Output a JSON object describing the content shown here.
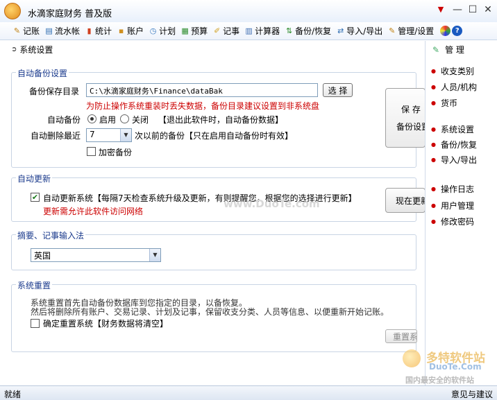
{
  "window": {
    "title": "水滴家庭财务  普及版",
    "controls": [
      "▼",
      "—",
      "☐",
      "✕"
    ]
  },
  "toolbar": {
    "items": [
      {
        "label": "记账",
        "icon": "pen-icon",
        "glyph": "✎",
        "color": "#c08010"
      },
      {
        "label": "流水帐",
        "icon": "list-icon",
        "glyph": "▤",
        "color": "#2a6ab0"
      },
      {
        "label": "统计",
        "icon": "bar-chart-icon",
        "glyph": "▮",
        "color": "#d04020"
      },
      {
        "label": "账户",
        "icon": "wallet-icon",
        "glyph": "▪",
        "color": "#d09020"
      },
      {
        "label": "计划",
        "icon": "plan-icon",
        "glyph": "◷",
        "color": "#3a7ac0"
      },
      {
        "label": "预算",
        "icon": "calculator-icon",
        "glyph": "▦",
        "color": "#2a8a2a"
      },
      {
        "label": "记事",
        "icon": "note-icon",
        "glyph": "✐",
        "color": "#d0a020"
      },
      {
        "label": "计算器",
        "icon": "calc-icon",
        "glyph": "▥",
        "color": "#3a6ab0"
      },
      {
        "label": "备份/恢复",
        "icon": "backup-icon",
        "glyph": "⇅",
        "color": "#2a8a2a"
      },
      {
        "label": "导入/导出",
        "icon": "import-export-icon",
        "glyph": "⇄",
        "color": "#2a6ab0"
      },
      {
        "label": "管理/设置",
        "icon": "settings-icon",
        "glyph": "✎",
        "color": "#c08010"
      }
    ]
  },
  "main": {
    "page_title": "系统设置",
    "backup": {
      "group_title": "自动备份设置",
      "dir_label": "备份保存目录",
      "dir_value": "C:\\水滴家庭财务\\Finance\\dataBak",
      "choose_button": "选 择",
      "warning": "为防止操作系统重装时丢失数据，备份目录建议设置到非系统盘",
      "auto_label": "自动备份",
      "opt_on": "启用",
      "opt_off": "关闭",
      "auto_note": "【退出此软件时，自动备份数据】",
      "delete_label": "自动删除最近",
      "delete_value": "7",
      "delete_note": "次以前的备份【只在启用自动备份时有效】",
      "encrypt_label": "加密备份",
      "save_button_line1": "保 存",
      "save_button_line2": "备份设置"
    },
    "update": {
      "group_title": "自动更新",
      "auto_update_label": "自动更新系统【每隔7天检查系统升级及更新，有则提醒您，根据您的选择进行更新】",
      "auto_update_checked": true,
      "note": "更新需允许此软件访问网络",
      "update_now_button": "现在更新"
    },
    "input_method": {
      "group_title": "摘要、记事输入法",
      "selected": "英国"
    },
    "reset": {
      "group_title": "系统重置",
      "desc_line1": "系统重置首先自动备份数据库到您指定的目录，以备恢复。",
      "desc_line2": "然后将删除所有账户、交易记录、计划及记事，保留收支分类、人员等信息、以便重新开始记账。",
      "confirm_label": "确定重置系统【财务数据将清空】",
      "confirm_checked": false,
      "reset_button": "重置系统"
    }
  },
  "sidebar": {
    "title": "管  理",
    "items": [
      "收支类别",
      "人员/机构",
      "货币",
      "系统设置",
      "备份/恢复",
      "导入/导出",
      "操作日志",
      "用户管理",
      "修改密码"
    ]
  },
  "statusbar": {
    "left": "就绪",
    "right": "意见与建议"
  },
  "watermark": {
    "center": "www.DuoTe.com",
    "logo_cn": "多特软件站",
    "logo_en": "DuoTe.Com",
    "logo_sub": "国内最安全的软件站"
  }
}
